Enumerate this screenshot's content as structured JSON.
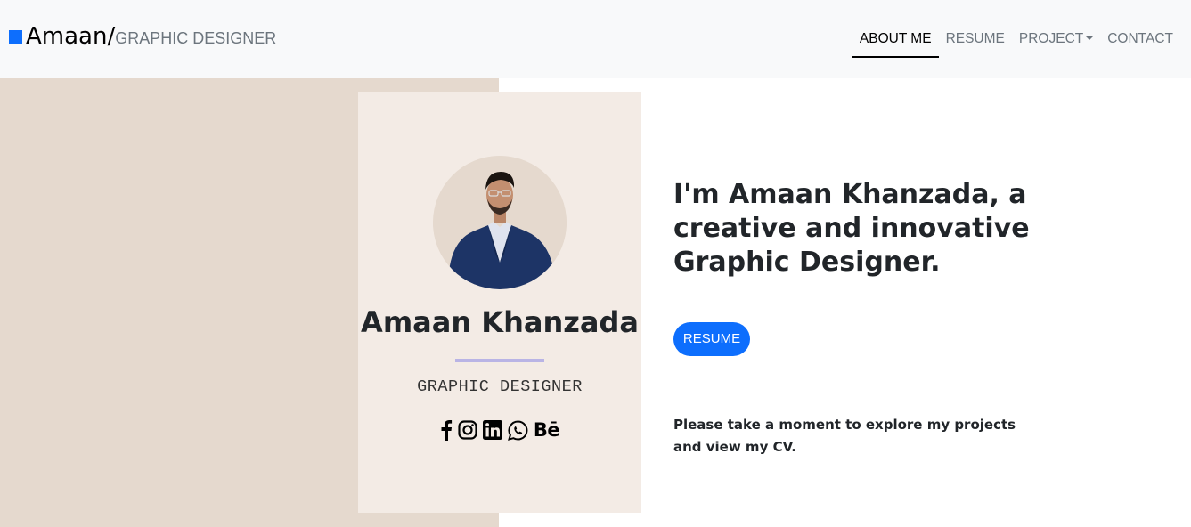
{
  "navbar": {
    "brand_name": "Amaan/",
    "brand_role": "GRAPHIC DESIGNER",
    "items": [
      {
        "label": "ABOUT ME",
        "active": true
      },
      {
        "label": "RESUME",
        "active": false
      },
      {
        "label": "PROJECT",
        "active": false,
        "dropdown": true
      },
      {
        "label": "CONTACT",
        "active": false
      }
    ]
  },
  "profile": {
    "name": "Amaan Khanzada",
    "role": "GRAPHIC DESIGNER",
    "socials": [
      "facebook-icon",
      "instagram-icon",
      "linkedin-icon",
      "whatsapp-icon",
      "behance-icon"
    ],
    "behance_text": "Bē"
  },
  "main": {
    "headline": "I'm Amaan Khanzada, a creative and innovative Graphic Designer.",
    "resume_button": "RESUME",
    "note": "Please take a moment to explore my projects and view my CV."
  },
  "colors": {
    "accent": "#0d6efd",
    "beige": "#e5d9ce",
    "card": "#f3ebe5",
    "divider": "#b9b4e5",
    "navbar_bg": "#f8f9fa"
  }
}
